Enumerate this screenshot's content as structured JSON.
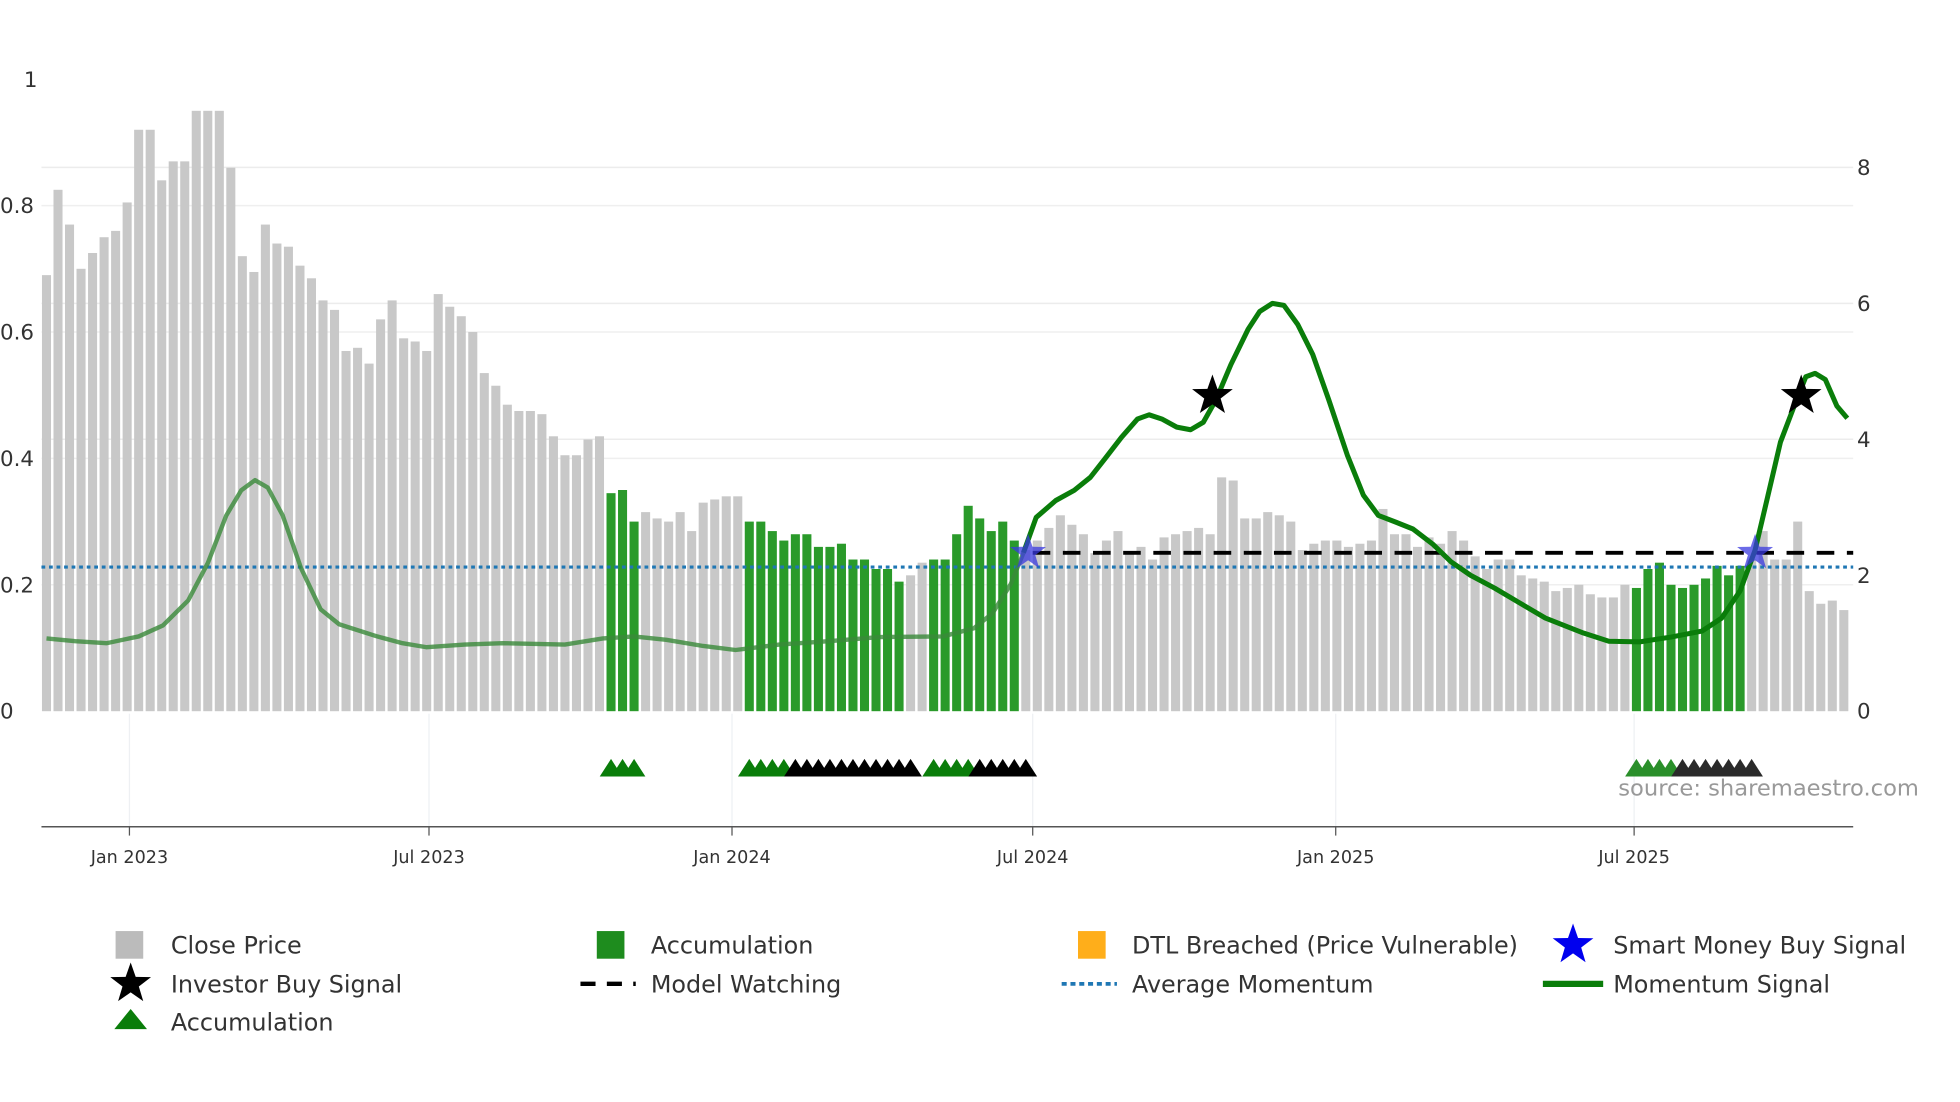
{
  "chart_data": {
    "type": "bar",
    "title": "",
    "x_unit": "weeks",
    "x_start_week": "Nov 2022",
    "left_axis": {
      "label": "",
      "ylim": [
        0,
        1
      ],
      "ticks": [
        "0",
        "0.2",
        "0.4",
        "0.6",
        "0.8",
        "1"
      ]
    },
    "right_axis": {
      "label": "",
      "ylim": [
        0,
        9.3
      ],
      "ticks": [
        "0",
        "2",
        "4",
        "6",
        "8"
      ]
    },
    "x_ticks": [
      {
        "label": "Jan 2023",
        "week": 7.2
      },
      {
        "label": "Jul 2023",
        "week": 33.2
      },
      {
        "label": "Jan 2024",
        "week": 59.5
      },
      {
        "label": "Jul 2024",
        "week": 85.6
      },
      {
        "label": "Jan 2025",
        "week": 111.9
      },
      {
        "label": "Jul 2025",
        "week": 137.8
      }
    ],
    "close_price": [
      0.69,
      0.825,
      0.77,
      0.7,
      0.725,
      0.75,
      0.76,
      0.805,
      0.92,
      0.92,
      0.84,
      0.87,
      0.87,
      0.95,
      0.95,
      0.95,
      0.86,
      0.72,
      0.695,
      0.77,
      0.74,
      0.735,
      0.705,
      0.685,
      0.65,
      0.635,
      0.57,
      0.575,
      0.55,
      0.62,
      0.65,
      0.59,
      0.585,
      0.57,
      0.66,
      0.64,
      0.625,
      0.6,
      0.535,
      0.515,
      0.485,
      0.475,
      0.475,
      0.47,
      0.435,
      0.405,
      0.405,
      0.43,
      0.435,
      0.345,
      0.35,
      0.3,
      0.315,
      0.305,
      0.3,
      0.315,
      0.285,
      0.33,
      0.335,
      0.34,
      0.34,
      0.3,
      0.3,
      0.285,
      0.27,
      0.28,
      0.28,
      0.26,
      0.26,
      0.265,
      0.24,
      0.24,
      0.225,
      0.225,
      0.205,
      0.215,
      0.235,
      0.24,
      0.24,
      0.28,
      0.325,
      0.305,
      0.285,
      0.3,
      0.27,
      0.255,
      0.27,
      0.29,
      0.31,
      0.295,
      0.28,
      0.25,
      0.27,
      0.285,
      0.25,
      0.26,
      0.24,
      0.275,
      0.28,
      0.285,
      0.29,
      0.28,
      0.37,
      0.365,
      0.305,
      0.305,
      0.315,
      0.31,
      0.3,
      0.255,
      0.265,
      0.27,
      0.27,
      0.26,
      0.265,
      0.27,
      0.32,
      0.28,
      0.28,
      0.26,
      0.275,
      0.265,
      0.285,
      0.27,
      0.245,
      0.225,
      0.24,
      0.24,
      0.215,
      0.21,
      0.205,
      0.19,
      0.195,
      0.2,
      0.185,
      0.18,
      0.18,
      0.2,
      0.195,
      0.225,
      0.235,
      0.2,
      0.195,
      0.2,
      0.21,
      0.23,
      0.215,
      0.23,
      0.24,
      0.285,
      0.24,
      0.24,
      0.3,
      0.19,
      0.17,
      0.175,
      0.16
    ],
    "accumulation_bar_ranges": [
      [
        49,
        51
      ],
      [
        61,
        74
      ],
      [
        77,
        84
      ],
      [
        138,
        147
      ]
    ],
    "momentum_signal": [
      [
        0,
        1.07
      ],
      [
        2.5,
        1.03
      ],
      [
        5.2,
        1.0
      ],
      [
        8,
        1.1
      ],
      [
        10.1,
        1.26
      ],
      [
        12.3,
        1.63
      ],
      [
        14,
        2.18
      ],
      [
        15.6,
        2.88
      ],
      [
        16.9,
        3.25
      ],
      [
        18.1,
        3.4
      ],
      [
        19.2,
        3.29
      ],
      [
        20.5,
        2.88
      ],
      [
        22.1,
        2.1
      ],
      [
        23.8,
        1.5
      ],
      [
        25.4,
        1.28
      ],
      [
        28.7,
        1.1
      ],
      [
        30.9,
        1.0
      ],
      [
        33,
        0.94
      ],
      [
        36.3,
        0.98
      ],
      [
        39.6,
        1.0
      ],
      [
        45,
        0.98
      ],
      [
        48.3,
        1.07
      ],
      [
        51,
        1.1
      ],
      [
        53.8,
        1.05
      ],
      [
        57,
        0.96
      ],
      [
        59.8,
        0.9
      ],
      [
        63.6,
        0.98
      ],
      [
        67.9,
        1.03
      ],
      [
        72.3,
        1.09
      ],
      [
        77.8,
        1.1
      ],
      [
        80.5,
        1.22
      ],
      [
        82.1,
        1.44
      ],
      [
        83.7,
        1.87
      ],
      [
        84.8,
        2.33
      ],
      [
        85.9,
        2.85
      ],
      [
        87.6,
        3.1
      ],
      [
        89.2,
        3.25
      ],
      [
        90.6,
        3.44
      ],
      [
        91.9,
        3.72
      ],
      [
        93.3,
        4.03
      ],
      [
        94.7,
        4.3
      ],
      [
        95.7,
        4.36
      ],
      [
        96.8,
        4.3
      ],
      [
        98.1,
        4.18
      ],
      [
        99.3,
        4.14
      ],
      [
        100.4,
        4.25
      ],
      [
        101.5,
        4.58
      ],
      [
        102.8,
        5.1
      ],
      [
        104.3,
        5.62
      ],
      [
        105.3,
        5.88
      ],
      [
        106.4,
        6.0
      ],
      [
        107.4,
        5.97
      ],
      [
        108.6,
        5.69
      ],
      [
        109.9,
        5.25
      ],
      [
        111.3,
        4.58
      ],
      [
        112.9,
        3.77
      ],
      [
        114.3,
        3.18
      ],
      [
        115.6,
        2.88
      ],
      [
        117,
        2.79
      ],
      [
        118.6,
        2.68
      ],
      [
        120.3,
        2.46
      ],
      [
        121.9,
        2.2
      ],
      [
        123.6,
        2.0
      ],
      [
        125.7,
        1.81
      ],
      [
        127.9,
        1.59
      ],
      [
        130.1,
        1.37
      ],
      [
        133.4,
        1.15
      ],
      [
        135.6,
        1.03
      ],
      [
        138.3,
        1.02
      ],
      [
        141,
        1.09
      ],
      [
        143.7,
        1.18
      ],
      [
        145.4,
        1.37
      ],
      [
        147,
        1.77
      ],
      [
        148.3,
        2.37
      ],
      [
        149.4,
        3.16
      ],
      [
        150.5,
        3.96
      ],
      [
        151.6,
        4.45
      ],
      [
        152.7,
        4.92
      ],
      [
        153.5,
        4.97
      ],
      [
        154.4,
        4.88
      ],
      [
        155.4,
        4.49
      ],
      [
        156.3,
        4.31
      ]
    ],
    "momentum_faded_before_week": 85,
    "average_momentum": 2.12,
    "model_watching": {
      "level": 2.33,
      "from_week": 85.6,
      "to_week": 157
    },
    "smart_money_buy_signals": [
      [
        85.2,
        2.33
      ],
      [
        148.3,
        2.33
      ]
    ],
    "investor_buy_signals": [
      [
        101.2,
        4.64
      ],
      [
        152.3,
        4.64
      ]
    ],
    "accumulation_triangles": [
      49,
      50,
      51,
      61,
      62,
      63,
      64,
      77,
      78,
      79,
      80,
      138,
      139,
      140,
      141
    ],
    "watching_triangles": [
      65,
      66,
      67,
      68,
      69,
      70,
      71,
      72,
      73,
      74,
      75,
      81,
      82,
      83,
      84,
      85,
      142,
      143,
      144,
      145,
      146,
      147,
      148
    ],
    "legend": [
      {
        "label": "Close Price",
        "symbol": "square",
        "color": "#bbbbbb"
      },
      {
        "label": "Accumulation",
        "symbol": "square",
        "color": "#1e8c1e"
      },
      {
        "label": "DTL Breached (Price Vulnerable)",
        "symbol": "square",
        "color": "#ffae1a"
      },
      {
        "label": "Smart Money Buy Signal",
        "symbol": "star",
        "color": "#0000ee"
      },
      {
        "label": "Investor Buy Signal",
        "symbol": "star",
        "color": "#000000"
      },
      {
        "label": "Model Watching",
        "symbol": "dash",
        "color": "#000000"
      },
      {
        "label": "Average Momentum",
        "symbol": "dot",
        "color": "#1f77b4"
      },
      {
        "label": "Momentum Signal",
        "symbol": "line",
        "color": "#0a7d0a"
      },
      {
        "label": "Accumulation",
        "symbol": "triangle",
        "color": "#0a7d0a"
      }
    ],
    "legend_placement": "bottom",
    "source": "source: sharemaestro.com"
  }
}
